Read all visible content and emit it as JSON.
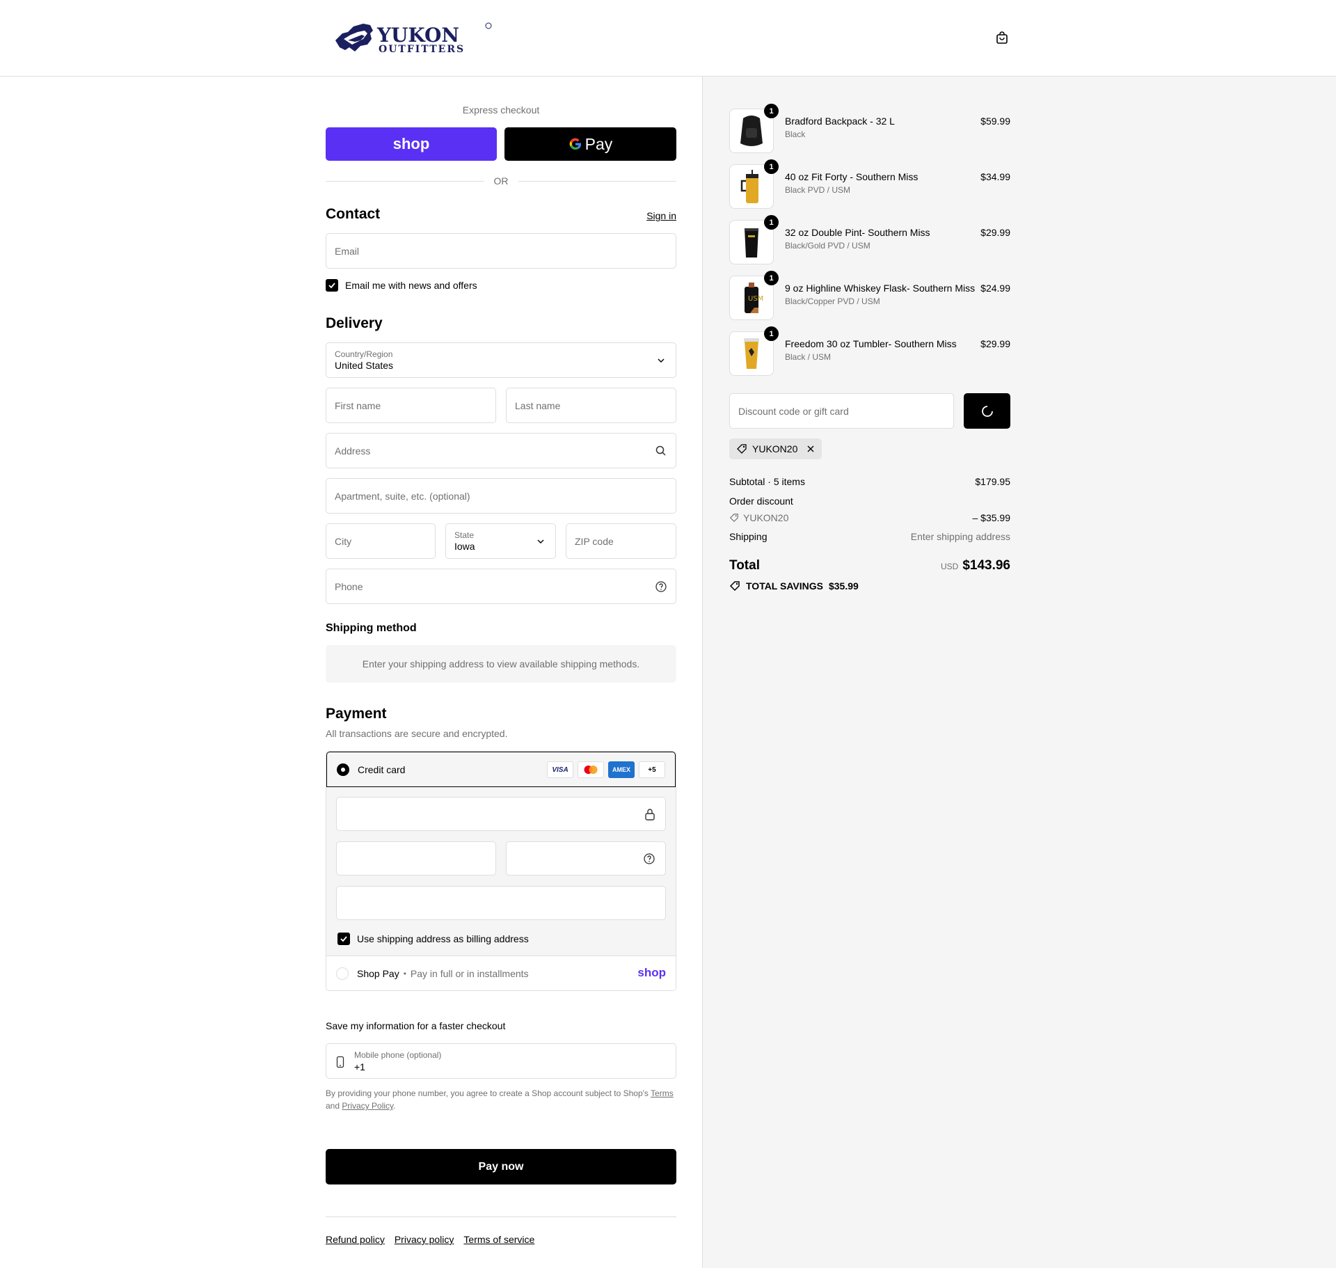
{
  "header": {
    "logo_main": "YUKON",
    "logo_sub": "OUTFITTERS"
  },
  "express": {
    "label": "Express checkout",
    "shop_label": "shop",
    "gpay_label": "Pay",
    "or_label": "OR"
  },
  "contact": {
    "title": "Contact",
    "sign_in": "Sign in",
    "email_placeholder": "Email",
    "news_label": "Email me with news and offers"
  },
  "delivery": {
    "title": "Delivery",
    "country_label": "Country/Region",
    "country_value": "United States",
    "first_name_placeholder": "First name",
    "last_name_placeholder": "Last name",
    "address_placeholder": "Address",
    "apartment_placeholder": "Apartment, suite, etc. (optional)",
    "city_placeholder": "City",
    "state_label": "State",
    "state_value": "Iowa",
    "zip_placeholder": "ZIP code",
    "phone_placeholder": "Phone"
  },
  "shipping_method": {
    "title": "Shipping method",
    "message": "Enter your shipping address to view available shipping methods."
  },
  "payment": {
    "title": "Payment",
    "subtitle": "All transactions are secure and encrypted.",
    "credit_card_label": "Credit card",
    "badges": [
      "VISA",
      "AMEX",
      "+5"
    ],
    "billing_label": "Use shipping address as billing address",
    "shop_pay_label": "Shop Pay",
    "shop_pay_sub": "Pay in full or in installments",
    "shop_pay_logo": "shop"
  },
  "save_info": {
    "title": "Save my information for a faster checkout",
    "phone_label": "Mobile phone (optional)",
    "phone_value": "+1",
    "disclaimer_text": "By providing your phone number, you agree to create a Shop account subject to Shop's",
    "terms": "Terms",
    "and": "and",
    "privacy": "Privacy Policy",
    "period": "."
  },
  "pay_now": "Pay now",
  "footer_links": [
    "Refund policy",
    "Privacy policy",
    "Terms of service"
  ],
  "cart": {
    "items": [
      {
        "name": "Bradford Backpack - 32 L",
        "variant": "Black",
        "price": "$59.99",
        "qty": "1"
      },
      {
        "name": "40 oz Fit Forty - Southern Miss",
        "variant": "Black PVD / USM",
        "price": "$34.99",
        "qty": "1"
      },
      {
        "name": "32 oz Double Pint- Southern Miss",
        "variant": "Black/Gold PVD / USM",
        "price": "$29.99",
        "qty": "1"
      },
      {
        "name": "9 oz Highline Whiskey Flask- Southern Miss",
        "variant": "Black/Copper PVD / USM",
        "price": "$24.99",
        "qty": "1"
      },
      {
        "name": "Freedom 30 oz Tumbler- Southern Miss",
        "variant": "Black / USM",
        "price": "$29.99",
        "qty": "1"
      }
    ],
    "discount_placeholder": "Discount code or gift card",
    "applied_code": "YUKON20",
    "subtotal_label": "Subtotal · 5 items",
    "subtotal_value": "$179.95",
    "order_discount_label": "Order discount",
    "discount_code": "YUKON20",
    "discount_value": "– $35.99",
    "shipping_label": "Shipping",
    "shipping_value": "Enter shipping address",
    "total_label": "Total",
    "currency": "USD",
    "total_value": "$143.96",
    "savings_label": "TOTAL SAVINGS",
    "savings_value": "$35.99"
  },
  "colors": {
    "shop_purple": "#5a31f4",
    "amex_blue": "#1f72cd",
    "border": "#dedede",
    "muted_text": "#707070",
    "panel_bg": "#f5f5f5"
  }
}
